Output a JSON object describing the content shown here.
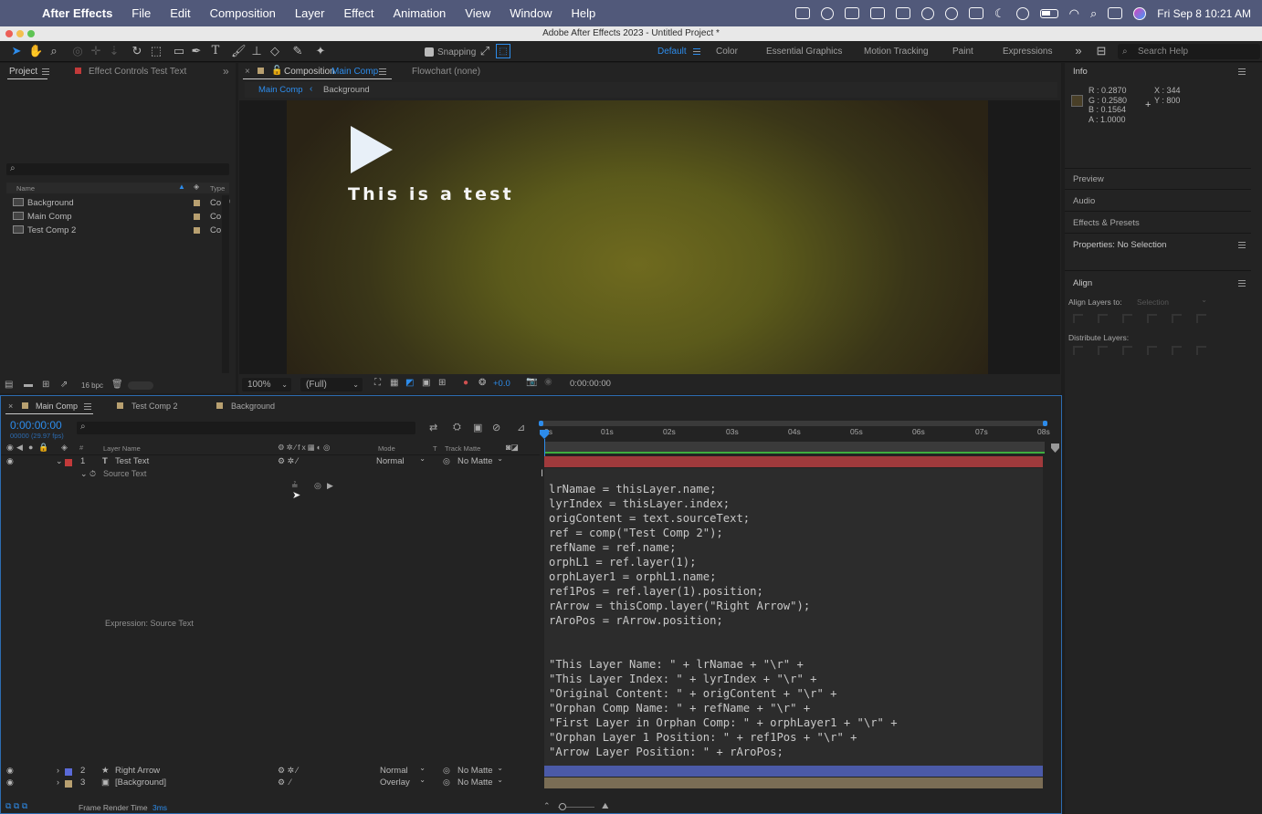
{
  "menubar": {
    "app_name": "After Effects",
    "items": [
      "File",
      "Edit",
      "Composition",
      "Layer",
      "Effect",
      "Animation",
      "View",
      "Window",
      "Help"
    ],
    "datetime": "Fri Sep 8  10:21 AM"
  },
  "window": {
    "title": "Adobe After Effects 2023 - Untitled Project *"
  },
  "toolbar": {
    "snapping_label": "Snapping",
    "workspaces": [
      {
        "label": "Default",
        "active": true
      },
      {
        "label": "Color",
        "active": false
      },
      {
        "label": "Essential Graphics",
        "active": false
      },
      {
        "label": "Motion Tracking",
        "active": false
      },
      {
        "label": "Paint",
        "active": false
      },
      {
        "label": "Expressions",
        "active": false
      }
    ],
    "search_placeholder": "Search Help"
  },
  "project_panel": {
    "tab_project": "Project",
    "tab_effect_controls": "Effect Controls Test Text",
    "col_name": "Name",
    "col_type": "Type",
    "items": [
      {
        "name": "Background",
        "type": "Co"
      },
      {
        "name": "Main Comp",
        "type": "Co"
      },
      {
        "name": "Test Comp 2",
        "type": "Co"
      }
    ],
    "bpc": "16 bpc"
  },
  "comp_panel": {
    "tab_prefix": "Composition",
    "tab_comp": "Main Comp",
    "flowchart": "Flowchart (none)",
    "breadcrumb_current": "Main Comp",
    "breadcrumb_parent": "Background",
    "canvas_text": "This is a test",
    "zoom": "100%",
    "resolution": "(Full)",
    "exposure": "+0.0",
    "timecode": "0:00:00:00"
  },
  "info_panel": {
    "title": "Info",
    "rgba": "R : 0.2870\nG : 0.2580\nB : 0.1564\nA : 1.0000",
    "xy": "X : 344\nY : 800",
    "swatch_color": "#493f27"
  },
  "right_panels": {
    "preview": "Preview",
    "audio": "Audio",
    "effects_presets": "Effects & Presets",
    "properties": "Properties: No Selection",
    "align": "Align",
    "align_layers_to": "Align Layers to:",
    "align_selection": "Selection",
    "distribute_layers": "Distribute Layers:"
  },
  "timeline": {
    "tabs": [
      "Main Comp",
      "Test Comp 2",
      "Background"
    ],
    "timecode": "0:00:00:00",
    "fps": "00000 (29.97 fps)",
    "col_layer_name": "Layer Name",
    "col_mode": "Mode",
    "col_t": "T",
    "col_track_matte": "Track Matte",
    "ticks": [
      "0s",
      "01s",
      "02s",
      "03s",
      "04s",
      "05s",
      "06s",
      "07s",
      "08s"
    ],
    "layers": [
      {
        "num": "1",
        "name": "Test Text",
        "mode": "Normal",
        "matte": "No Matte",
        "color": "#c23a3a",
        "type_icon": "T"
      },
      {
        "num": "2",
        "name": "Right Arrow",
        "mode": "Normal",
        "matte": "No Matte",
        "color": "#5a6ad8",
        "type_icon": "★"
      },
      {
        "num": "3",
        "name": "[Background]",
        "mode": "Overlay",
        "matte": "No Matte",
        "color": "#b8a070",
        "type_icon": "▣"
      }
    ],
    "source_text": "Source Text",
    "expression_label": "Expression: Source Text",
    "expression_code": "lrNamae = thisLayer.name;\nlyrIndex = thisLayer.index;\norigContent = text.sourceText;\nref = comp(\"Test Comp 2\");\nrefName = ref.name;\norphL1 = ref.layer(1);\norphLayer1 = orphL1.name;\nref1Pos = ref.layer(1).position;\nrArrow = thisComp.layer(\"Right Arrow\");\nrAroPos = rArrow.position;\n\n\n\"This Layer Name: \" + lrNamae + \"\\r\" +\n\"This Layer Index: \" + lyrIndex + \"\\r\" +\n\"Original Content: \" + origContent + \"\\r\" +\n\"Orphan Comp Name: \" + refName + \"\\r\" +\n\"First Layer in Orphan Comp: \" + orphLayer1 + \"\\r\" +\n\"Orphan Layer 1 Position: \" + ref1Pos + \"\\r\" +\n\"Arrow Layer Position: \" + rAroPos;",
    "frame_render_label": "Frame Render Time",
    "frame_render_value": "3ms"
  }
}
